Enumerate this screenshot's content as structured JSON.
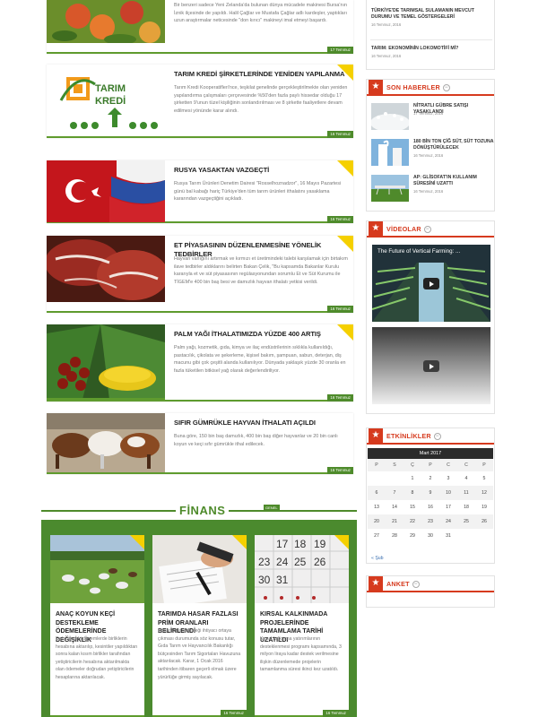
{
  "top_partial": {
    "body": "Bir benzeri sadece Yeni Zelanda'da bulunan dünya mücadele makinesi Bursa'nın İznik ilçesinde de yapıldı. Halil Çağlar ve Mustafa Çağlar adlı kardeşler, yaptıkları uzun araştırmalar neticesinde \"don kırıcı\" makineyi imal etmeyi başardı.",
    "date": "17 Temmuz"
  },
  "articles": [
    {
      "title": "TARIM KREDİ ŞİRKETLERİNDE YENİDEN YAPILANMA",
      "body": "Tarım Kredi Kooperatifleri'nce, teşkilat genelinde gerçekleştirilmekte olan yeniden yapılandırma çalışmaları çerçevesinde %50'den fazla paylı hissedar olduğu 17 şirketten 9'unun tüzel kişiliğinin sonlandırılması ve 8 şirkette faaliyetlere devam edilmesi yönünde karar alındı.",
      "date": "16 Temmuz",
      "logo": "TARIM KREDİ"
    },
    {
      "title": "RUSYA YASAKTAN VAZGEÇTİ",
      "body": "Rusya Tarım Ürünleri Denetim Dairesi \"Rosselhoznadzor\", 16 Mayıs Pazartesi günü bal kabağı hariç Türkiye'den tüm tarım ürünleri ithalatını yasaklama kararından vazgeçtiğini açıkladı.",
      "date": "16 Temmuz"
    },
    {
      "title": "ET PİYASASININ DÜZENLENMESİNE YÖNELİK TEDBİRLER",
      "body": "Hayvan varlığını artırmak ve kırmızı et üretimindeki talebi karşılamak için birtakım ilave tedbirler aldıklarını belirten Bakan Çelik, \"Bu kapsamda Bakanlar Kurulu kararıyla et ve süt piyasasının regülasyonundan sorumlu Et ve Süt Kurumu ile TİGEM'e 400 bin baş besi ve damızlık hayvan ithalatı yetkisi verildi.",
      "date": "16 Temmuz"
    },
    {
      "title": "PALM YAĞI İTHALATIMIZDA YÜZDE 400 ARTIŞ",
      "body": "Palm yağı, kozmetik, gıda, kimya ve ilaç endüstrilerinin sıklıkla kullanıldığı, pastacılık, çikolata ve şekerleme, kişisel bakım, şampuan, sabun, deterjan, diş macunu gibi çok çeşitli alanda kullanılıyor. Dünyada yaklaşık yüzde 30 oranla en fazla tüketilen bitkisel yağ olarak değerlendiriliyor.",
      "date": "16 Temmuz"
    },
    {
      "title": "SIFIR GÜMRÜKLE HAYVAN İTHALATI AÇILDI",
      "body": "Buna göre, 150 bin baş damızlık, 400 bin baş diğer hayvanlar ve 20 bin canlı koyun ve keçi sıfır gümrükle ithal edilecek.",
      "date": "16 Temmuz"
    }
  ],
  "finans": {
    "label": "FİNANS",
    "badge": "GENEL",
    "cards": [
      {
        "title": "ANAÇ KOYUN KEÇİ DESTEKLEME ÖDEMELERİNDE DEĞİŞİKLİK",
        "body": "Daha önceki dönemlerde birliklerin hesabına aktarılıp, kesintiler yapıldıktan sonra kalan kısım birlikler tarafından yetiştiricilerin hesabına aktarılmakta olan ödemeler doğrudan yetiştiricilerin hesaplarına aktarılacak.",
        "date": ""
      },
      {
        "title": "TARIMDA HASAR FAZLASI PRİM ORANLARI BELİRLENDİ",
        "body": "Hasar fazlası desteği ihtiyacı ortaya çıkması durumunda söz konusu tutar, Gıda Tarım ve Hayvancılık Bakanlığı bütçesinden Tarım Sigortaları Havuzuna aktarılacak. Karar, 1 Ocak 2016 tarihinden itibaren geçerli olmak üzere yürürlüğe girmiş sayılacak.",
        "date": "16 Temmuz"
      },
      {
        "title": "KIRSAL KALKINMADA PROJELERİNDE TAMAMLAMA TARİHİ UZATILDI",
        "body": "Kırsal kalkınma yatırımlarının desteklenmesi programı kapsamında, 3 milyon liraya kadar destek verilmesine ilişkin düzenlemede projelerin tamamlanma süresi ikinci kez uzatıldı.",
        "date": "16 Temmuz"
      }
    ]
  },
  "sidebar": {
    "top_items": [
      {
        "title": "TÜRKİYE'DE TARIMSAL SULAMANIN MEVCUT DURUMU VE TEMEL GÖSTERGELERİ",
        "date": "16 Temmuz, 2016"
      },
      {
        "title": "TARIM: EKONOMİNİN LOKOMOTİFİ Mİ?",
        "date": "16 Temmuz, 2016"
      }
    ],
    "son_haberler": {
      "title": "SON HABERLER",
      "items": [
        {
          "title": "NİTRATLI GÜBRE SATIŞI YASAKLANDI",
          "date": "17 Temmuz, 2016"
        },
        {
          "title": "180 BİN TON ÇİĞ SÜT, SÜT TOZUNA DÖNÜŞTÜRÜLECEK",
          "date": "16 Temmuz, 2016"
        },
        {
          "title": "AP: GLİSOFAT'IN KULLANIM SÜRESİNİ UZATTI",
          "date": "16 Temmuz, 2016"
        }
      ]
    },
    "videolar": {
      "title": "VİDEOLAR",
      "video1_title": "The Future of Vertical Farming: ..."
    },
    "etkinlikler": {
      "title": "ETKİNLİKLER",
      "month": "Mart 2017",
      "days": [
        "P",
        "S",
        "Ç",
        "P",
        "C",
        "C",
        "P"
      ],
      "weeks": [
        [
          "",
          "",
          "1",
          "2",
          "3",
          "4",
          "5"
        ],
        [
          "6",
          "7",
          "8",
          "9",
          "10",
          "11",
          "12"
        ],
        [
          "13",
          "14",
          "15",
          "16",
          "17",
          "18",
          "19"
        ],
        [
          "20",
          "21",
          "22",
          "23",
          "24",
          "25",
          "26"
        ],
        [
          "27",
          "28",
          "29",
          "30",
          "31",
          "",
          ""
        ]
      ],
      "prev": "« Şub"
    },
    "anket": {
      "title": "ANKET"
    }
  },
  "colors": {
    "green": "#4e8b2b",
    "red": "#d63a1e",
    "yellow": "#f5d000"
  }
}
